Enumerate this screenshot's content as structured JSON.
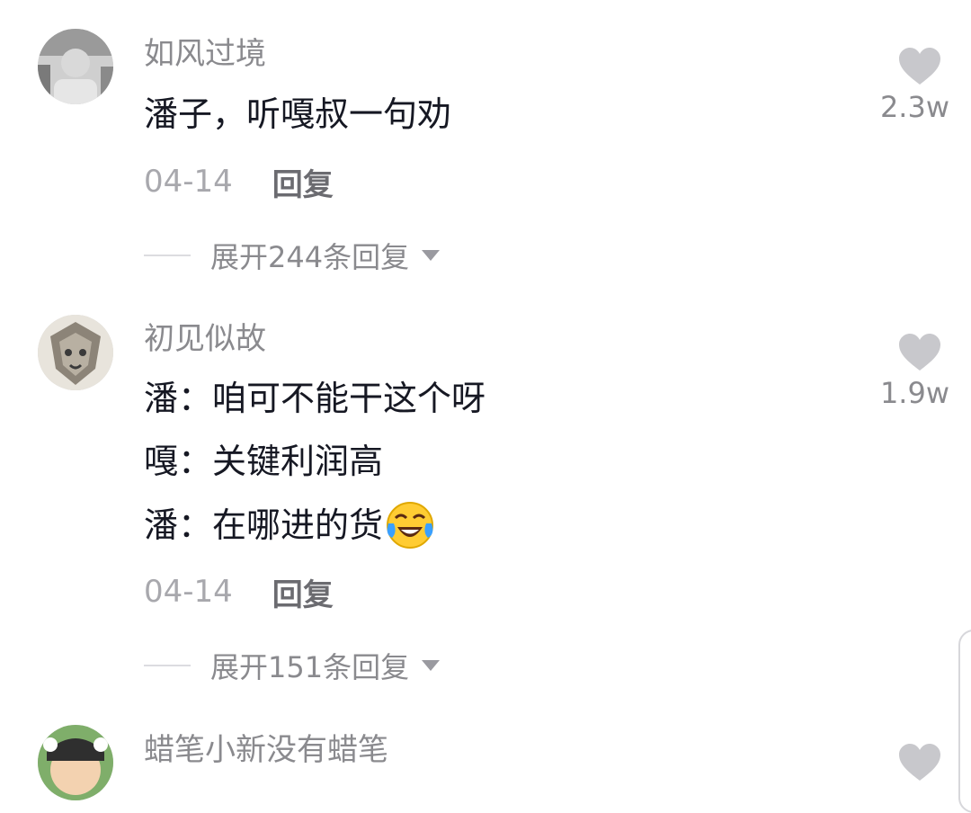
{
  "comments": [
    {
      "username": "如风过境",
      "lines": [
        "潘子，听嘎叔一句劝"
      ],
      "likes": "2.3w",
      "date": "04-14",
      "reply": "回复",
      "expand": "展开244条回复"
    },
    {
      "username": "初见似故",
      "lines": [
        "潘：咱可不能干这个呀",
        "嘎：关键利润高",
        "潘：在哪进的货"
      ],
      "likes": "1.9w",
      "date": "04-14",
      "reply": "回复",
      "expand": "展开151条回复"
    },
    {
      "username": "蜡笔小新没有蜡笔"
    }
  ],
  "colors": {
    "heart": "#c8c8cc",
    "text_primary": "#161823",
    "text_secondary": "#8a8a8e"
  },
  "icons": [
    "heart-icon",
    "laughing-tears-emoji",
    "caret-down-icon"
  ]
}
